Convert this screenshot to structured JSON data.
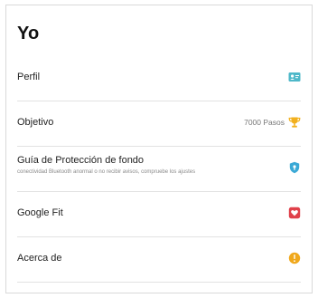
{
  "page": {
    "title": "Yo"
  },
  "menu": {
    "items": [
      {
        "id": "perfil",
        "label": "Perfil",
        "icon": "profile-card-icon"
      },
      {
        "id": "objetivo",
        "label": "Objetivo",
        "value": "7000 Pasos",
        "icon": "trophy-icon"
      },
      {
        "id": "proteccion",
        "label": "Guía de Protección de fondo",
        "sublabel": "conectividad Bluetooth anormal o no recibir avisos, compruebe los ajustes",
        "icon": "shield-lock-icon"
      },
      {
        "id": "google-fit",
        "label": "Google Fit",
        "icon": "google-fit-heart-icon"
      },
      {
        "id": "acerca",
        "label": "Acerca de",
        "icon": "info-icon"
      }
    ]
  },
  "colors": {
    "profile_icon": "#4fb8c9",
    "trophy_icon": "#f2b01e",
    "shield_icon": "#3aa9d6",
    "google_fit_icon": "#e0404a",
    "info_icon": "#f0a81c"
  }
}
